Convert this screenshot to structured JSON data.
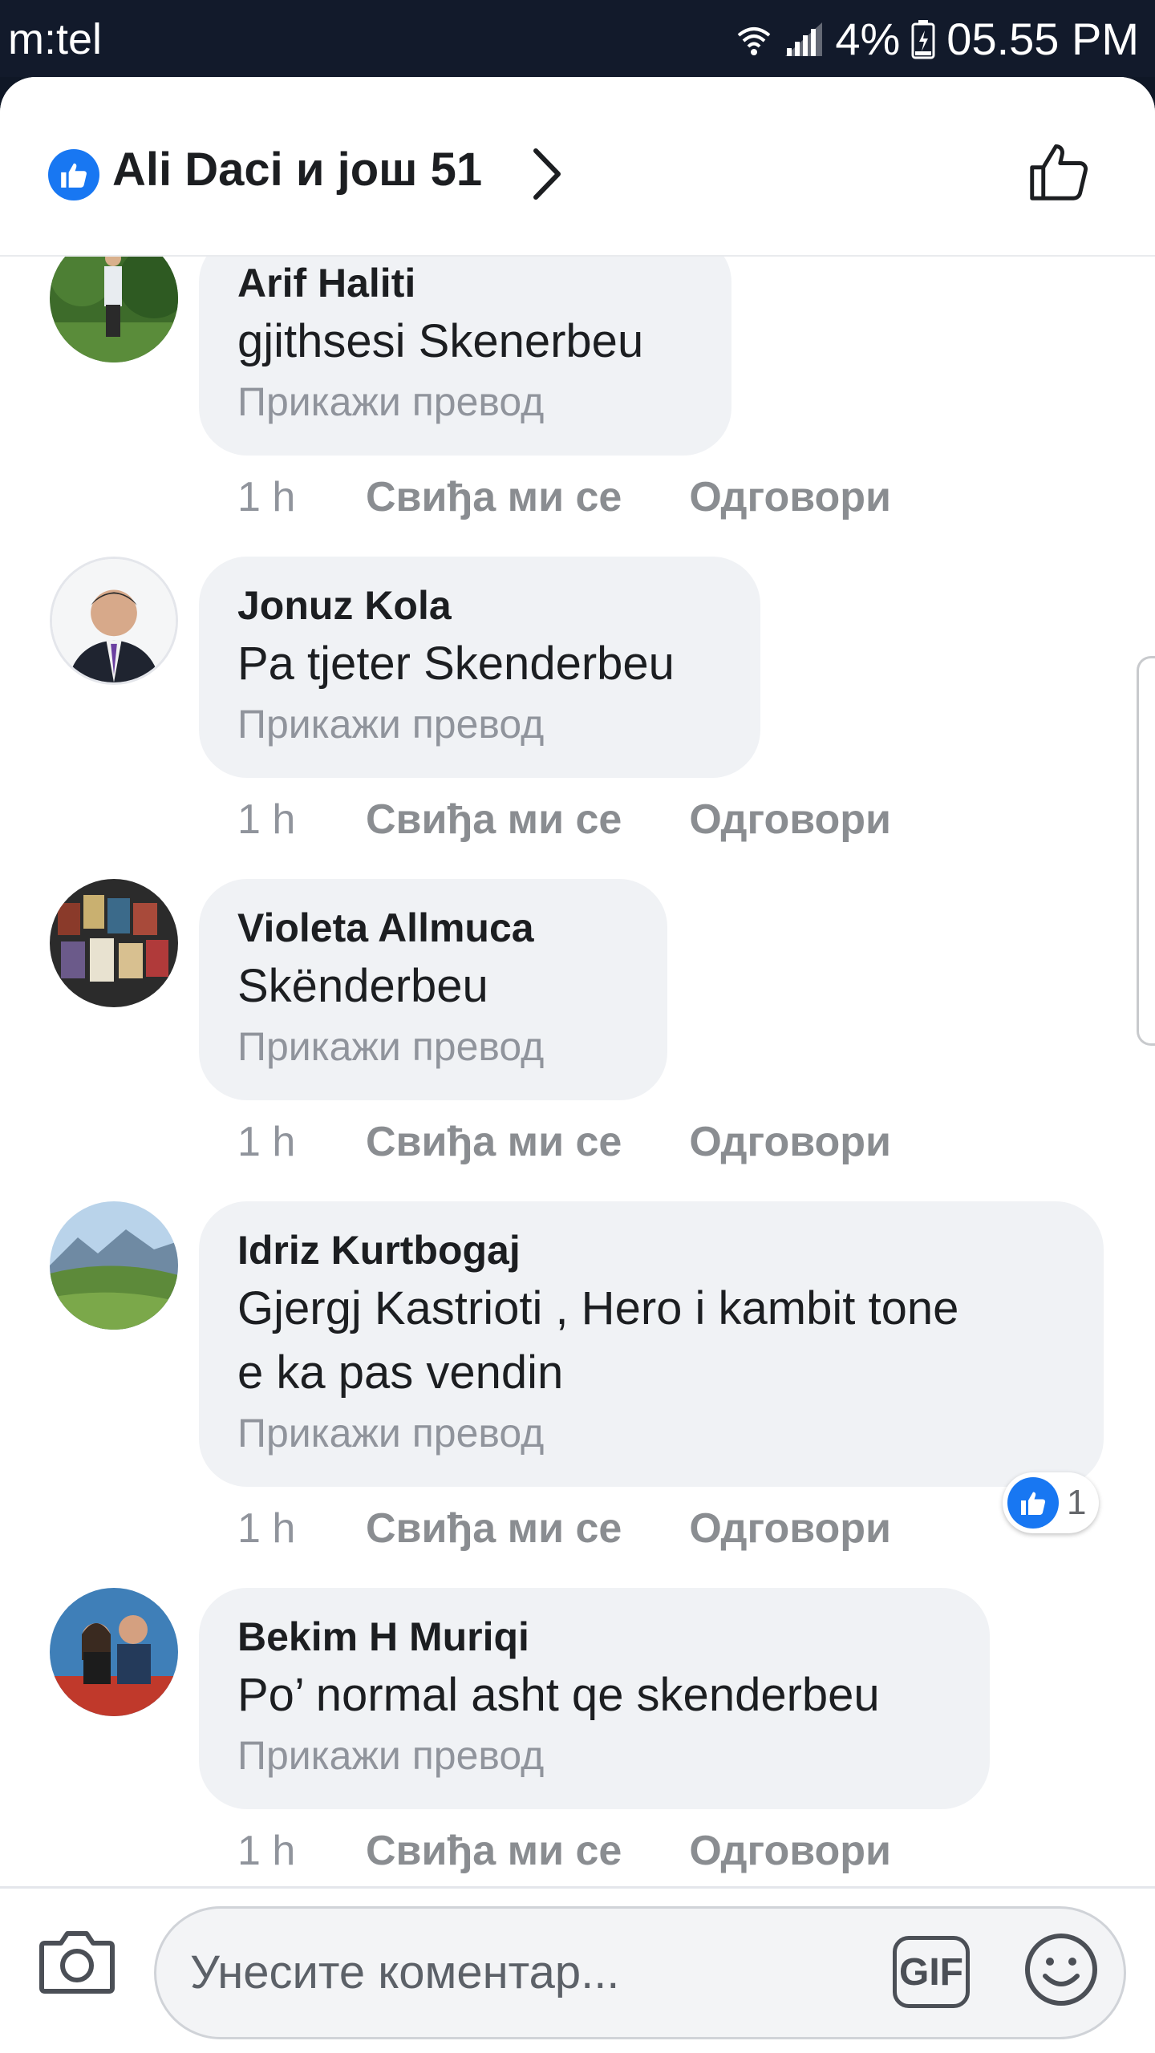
{
  "status_bar": {
    "carrier": "m:tel",
    "battery": "4%",
    "time": "05.55 PM"
  },
  "header": {
    "title": "Ali Daci и још 51"
  },
  "comments": [
    {
      "author": "Arif Haliti",
      "text": "gjithsesi Skenerbeu",
      "translate": "Прикажи превод",
      "time": "1 h",
      "like": "Свиђа ми се",
      "reply": "Одговори"
    },
    {
      "author": "Jonuz Kola",
      "text": "Pa tjeter Skenderbeu",
      "translate": "Прикажи превод",
      "time": "1 h",
      "like": "Свиђа ми се",
      "reply": "Одговори"
    },
    {
      "author": "Violeta Allmuca",
      "text": "Skënderbeu",
      "translate": "Прикажи превод",
      "time": "1 h",
      "like": "Свиђа ми се",
      "reply": "Одговори"
    },
    {
      "author": "Idriz Kurtbogaj",
      "text_line1": "Gjergj Kastrioti , Hero i kambit tone",
      "text_line2": "e ka pas vendin",
      "translate": "Прикажи превод",
      "time": "1 h",
      "like": "Свиђа ми се",
      "reply": "Одговори",
      "reaction_count": "1"
    },
    {
      "author": "Bekim H Muriqi",
      "text": "Po’ normal asht qe skenderbeu",
      "translate": "Прикажи превод",
      "time": "1 h",
      "like": "Свиђа ми се",
      "reply": "Одговори"
    }
  ],
  "composer": {
    "placeholder": "Унесите коментар...",
    "gif_label": "GIF"
  },
  "colors": {
    "accent": "#1877f2",
    "bubble": "#f0f2f5",
    "status_bar": "#121a2b"
  }
}
